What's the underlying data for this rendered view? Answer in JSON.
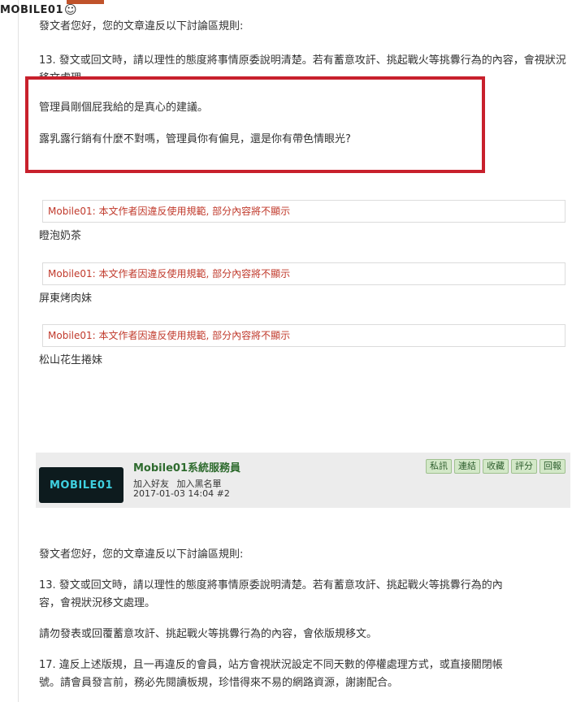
{
  "site": {
    "logo_text": "MOBILE01"
  },
  "post1": {
    "greeting": "發文者您好，您的文章違反以下討論區規則:",
    "rule13": "13. 發文或回文時，請以理性的態度將事情原委說明清楚。若有蓄意攻訐、挑起戰火等挑釁行為的內容，會視狀況移文處理",
    "quote_line1": "管理員剛個屁我給的是真心的建議。",
    "quote_line2": "露乳露行銷有什麼不對嗎，管理員你有偏見，還是你有帶色情眼光?"
  },
  "notices": [
    {
      "text": "Mobile01: 本文作者因違反使用規範, 部分內容將不顯示",
      "signature": "瞪泡奶茶"
    },
    {
      "text": "Mobile01: 本文作者因違反使用規範, 部分內容將不顯示",
      "signature": "屏東烤肉妹"
    },
    {
      "text": "Mobile01: 本文作者因違反使用規範, 部分內容將不顯示",
      "signature": "松山花生捲妹"
    }
  ],
  "post2": {
    "username": "Mobile01系統服務員",
    "add_friend": "加入好友",
    "add_blacklist": "加入黑名單",
    "meta": "2017-01-03 14:04  #2",
    "avatar_text": "MOBILE01",
    "buttons": [
      "私訊",
      "連結",
      "收藏",
      "評分",
      "回報"
    ],
    "greeting": "發文者您好，您的文章違反以下討論區規則:",
    "rule13_line1": "13. 發文或回文時，請以理性的態度將事情原委說明清楚。若有蓄意攻訐、挑起戰火等挑釁行為的內",
    "rule13_line2": "容，會視狀況移文處理。",
    "warning": "請勿發表或回覆蓄意攻訐、挑起戰火等挑釁行為的內容，會依版規移文。",
    "rule17_line1": "17. 違反上述版規，且一再違反的會員，站方會視狀況設定不同天數的停權處理方式，或直接關閉帳",
    "rule17_line2": "號。請會員發言前，務必先閱讀板規，珍惜得來不易的網路資源，謝謝配合。"
  }
}
